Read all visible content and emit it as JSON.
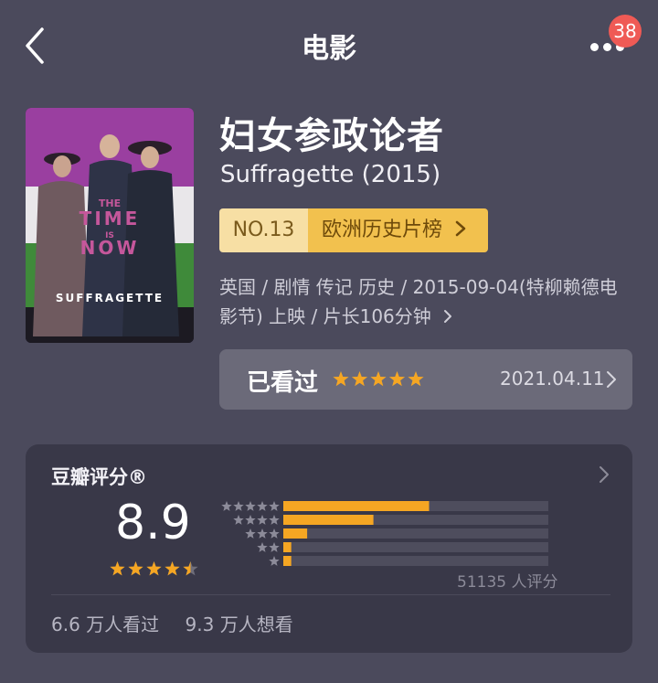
{
  "nav": {
    "title": "电影",
    "badge_count": "38"
  },
  "movie": {
    "title_zh": "妇女参政论者",
    "title_en": "Suffragette (2015)",
    "poster_text": {
      "line1": "THE",
      "line2": "TIME",
      "line3": "IS",
      "line4": "NOW",
      "brand": "SUFFRAGETTE"
    },
    "rank_no": "NO.13",
    "rank_list": "欧洲历史片榜",
    "meta_line1": "英国 / 剧情 传记 历史 / 2015-09-04(特柳赖德电",
    "meta_line2": "影节) 上映 / 片长106分钟"
  },
  "watched": {
    "label": "已看过",
    "stars": 5,
    "date": "2021.04.11"
  },
  "rating": {
    "header": "豆瓣评分®",
    "score": "8.9",
    "score_stars": 4.5,
    "distribution": [
      0.55,
      0.34,
      0.09,
      0.03,
      0.03
    ],
    "count_text": "51135 人评分",
    "watched_text": "6.6 万人看过",
    "wish_text": "9.3 万人想看"
  },
  "colors": {
    "background": "#4b4a5c",
    "star": "#f5a623",
    "bar_fill": "#f5a623",
    "bar_track": "#4e4d5d",
    "badge": "#ef5a55",
    "rank_no_bg": "#f7dfa4",
    "rank_list_bg": "#f2c14e"
  }
}
